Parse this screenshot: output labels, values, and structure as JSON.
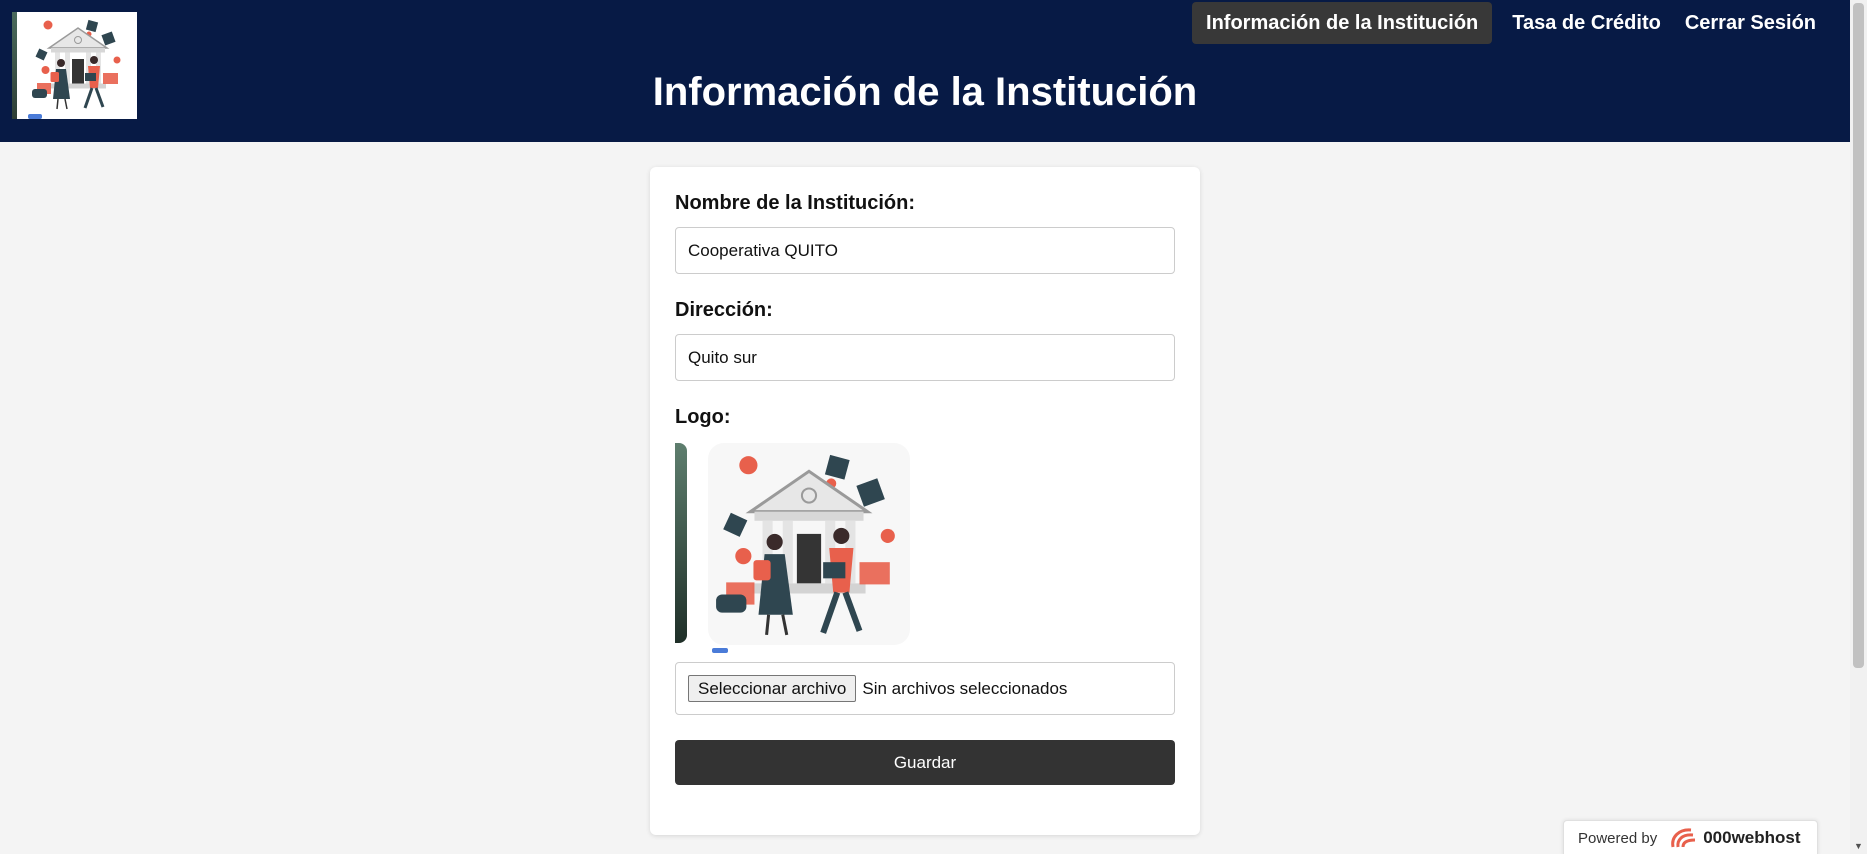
{
  "header": {
    "title": "Información de la Institución",
    "logo_icon": "bank-illustration-icon"
  },
  "nav": {
    "items": [
      {
        "label": "Información de la Institución",
        "active": true
      },
      {
        "label": "Tasa de Crédito",
        "active": false
      },
      {
        "label": "Cerrar Sesión",
        "active": false
      }
    ]
  },
  "form": {
    "name_label": "Nombre de la Institución:",
    "name_value": "Cooperativa QUITO",
    "address_label": "Dirección:",
    "address_value": "Quito sur",
    "logo_label": "Logo:",
    "file_button_label": "Seleccionar archivo",
    "file_status": "Sin archivos seleccionados",
    "save_label": "Guardar"
  },
  "footer": {
    "powered_by": "Powered by",
    "brand": "000webhost"
  },
  "colors": {
    "header_bg": "#071a45",
    "nav_active_bg": "#383838",
    "button_bg": "#333333",
    "page_bg": "#f4f4f4",
    "accent_red": "#e8604c"
  }
}
